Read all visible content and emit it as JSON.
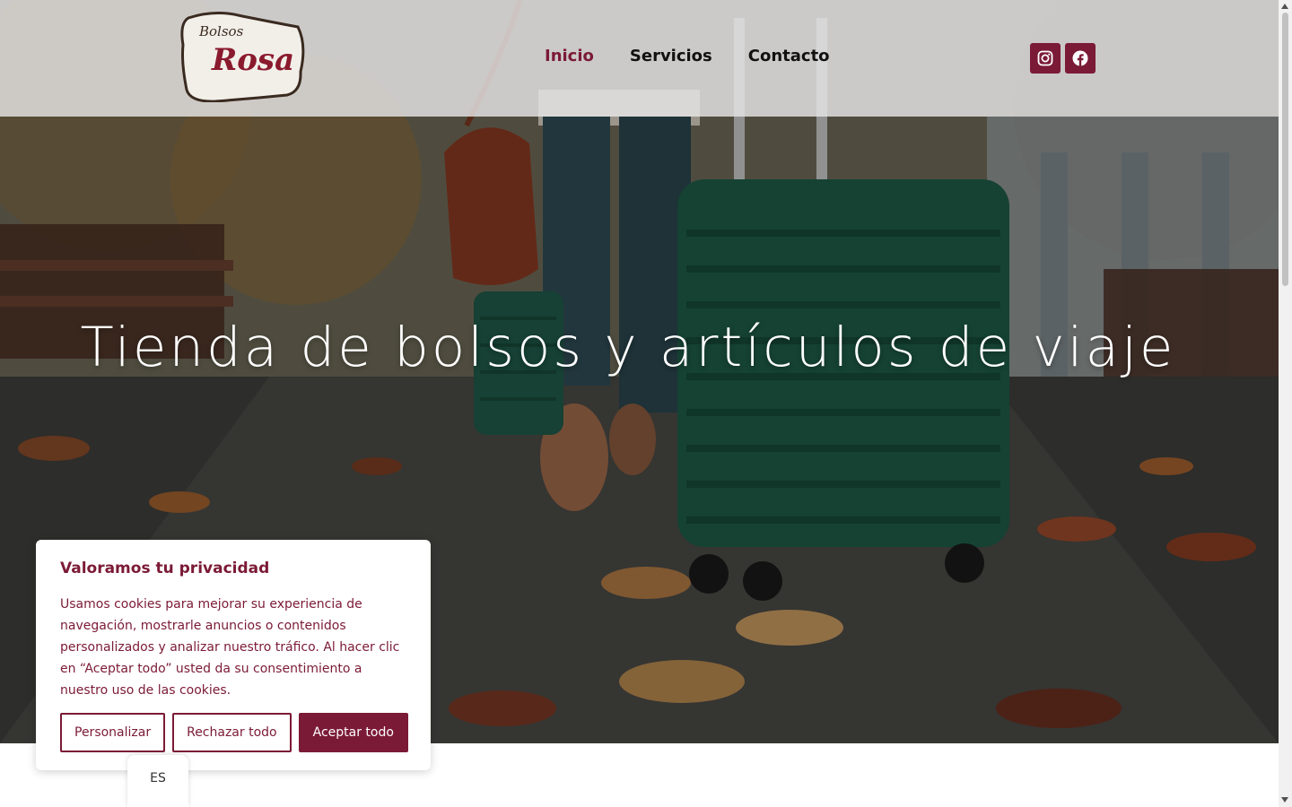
{
  "brand": {
    "logo_small": "Bolsos",
    "logo_big": "Rosa",
    "accent_color": "#7b1a36"
  },
  "nav": {
    "items": [
      {
        "label": "Inicio",
        "active": true
      },
      {
        "label": "Servicios",
        "active": false
      },
      {
        "label": "Contacto",
        "active": false
      }
    ]
  },
  "socials": [
    {
      "icon": "instagram-icon"
    },
    {
      "icon": "facebook-icon"
    }
  ],
  "hero": {
    "title": "Tienda de bolsos y artículos de viaje"
  },
  "cookie": {
    "title": "Valoramos tu privacidad",
    "text": "Usamos cookies para mejorar su experiencia de navegación, mostrarle anuncios o contenidos personalizados y analizar nuestro tráfico. Al hacer clic en “Aceptar todo” usted da su consentimiento a nuestro uso de las cookies.",
    "customize_label": "Personalizar",
    "reject_label": "Rechazar todo",
    "accept_label": "Aceptar todo"
  },
  "language": {
    "current": "ES"
  }
}
